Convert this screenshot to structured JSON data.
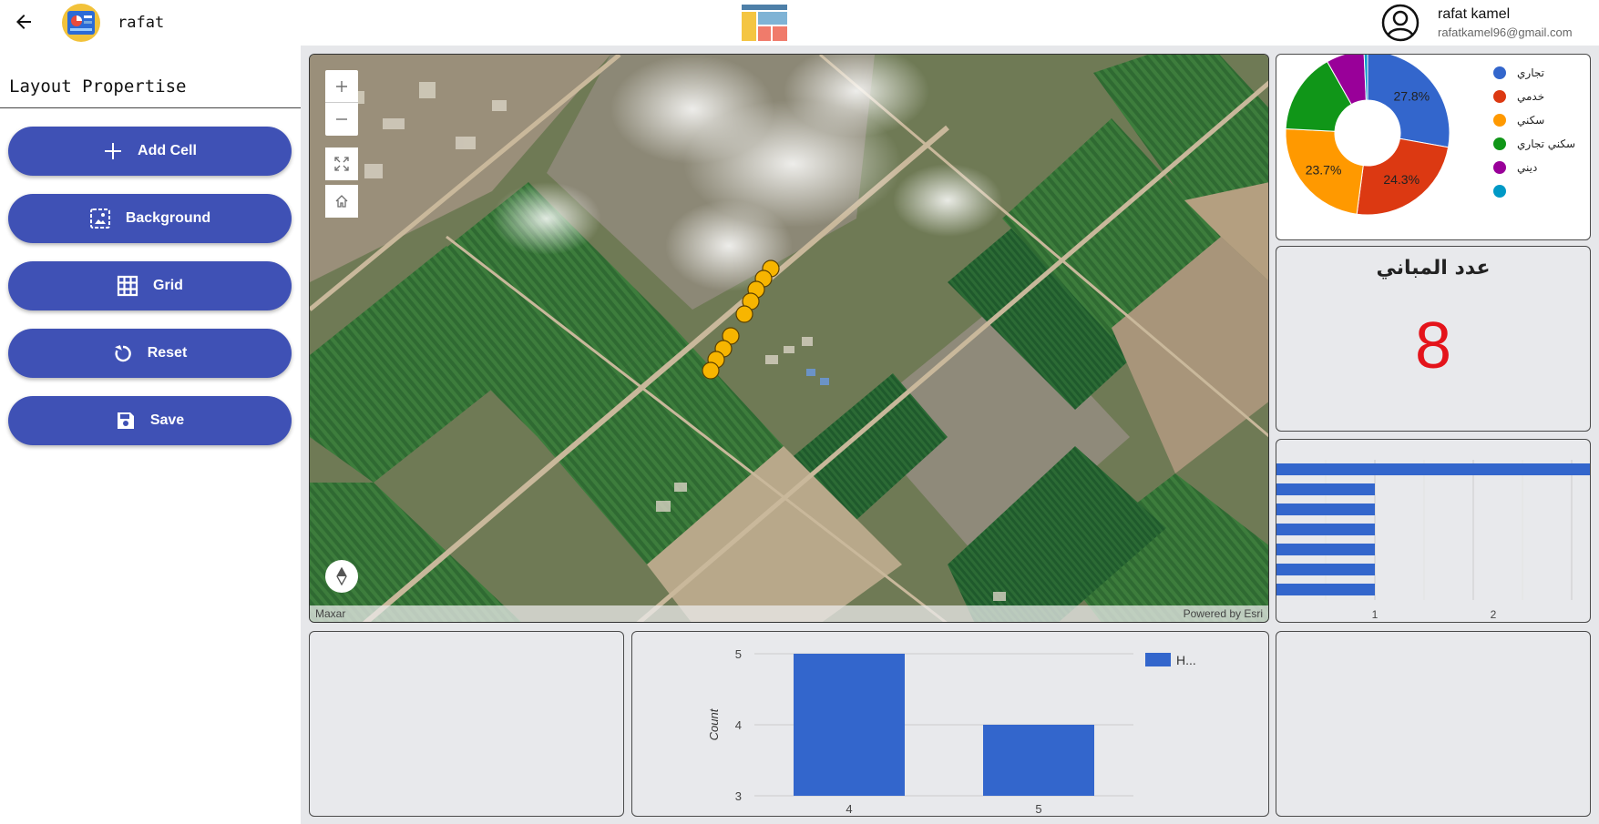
{
  "header": {
    "app_name": "rafat",
    "user_name": "rafat kamel",
    "user_email": "rafatkamel96@gmail.com"
  },
  "sidebar": {
    "title": "Layout Propertise",
    "buttons": [
      {
        "label": "Add Cell",
        "icon": "plus-icon"
      },
      {
        "label": "Background",
        "icon": "image-icon"
      },
      {
        "label": "Grid",
        "icon": "grid-icon"
      },
      {
        "label": "Reset",
        "icon": "reset-icon"
      },
      {
        "label": "Save",
        "icon": "save-icon"
      }
    ]
  },
  "map": {
    "attribution_left": "Maxar",
    "attribution_right": "Powered by Esri",
    "controls": [
      "zoom-in-icon",
      "zoom-out-icon",
      "fullscreen-icon",
      "home-icon",
      "compass-icon"
    ]
  },
  "count_widget": {
    "title": "عدد المباني",
    "value": "8",
    "value_color": "#e4141b"
  },
  "colors": {
    "accent": "#3f51b5",
    "chart_blue": "#3366cc"
  },
  "chart_data": [
    {
      "type": "pie",
      "donut": true,
      "labels": [
        "تجاري",
        "خدمي",
        "سكني",
        "سكني تجاري",
        "ديني",
        ""
      ],
      "values": [
        27.8,
        24.3,
        23.7,
        16.0,
        7.5,
        0.7
      ],
      "data_labels": [
        "27.8%",
        "24.3%",
        "23.7%",
        "",
        "",
        ""
      ],
      "colors": [
        "#3366cc",
        "#dc3912",
        "#ff9900",
        "#109618",
        "#990099",
        "#0099c6"
      ],
      "legend": "right"
    },
    {
      "type": "bar",
      "orientation": "horizontal",
      "values": [
        2,
        1,
        1,
        1,
        1,
        1,
        1
      ],
      "x_ticks": [
        "1",
        "2"
      ],
      "color": "#3366cc"
    },
    {
      "type": "bar",
      "categories": [
        "4",
        "5"
      ],
      "values": [
        5,
        4
      ],
      "ylabel": "Count",
      "ylim": [
        3,
        5
      ],
      "y_ticks": [
        "5",
        "4",
        "3"
      ],
      "legend_label": "H...",
      "color": "#3366cc"
    }
  ]
}
